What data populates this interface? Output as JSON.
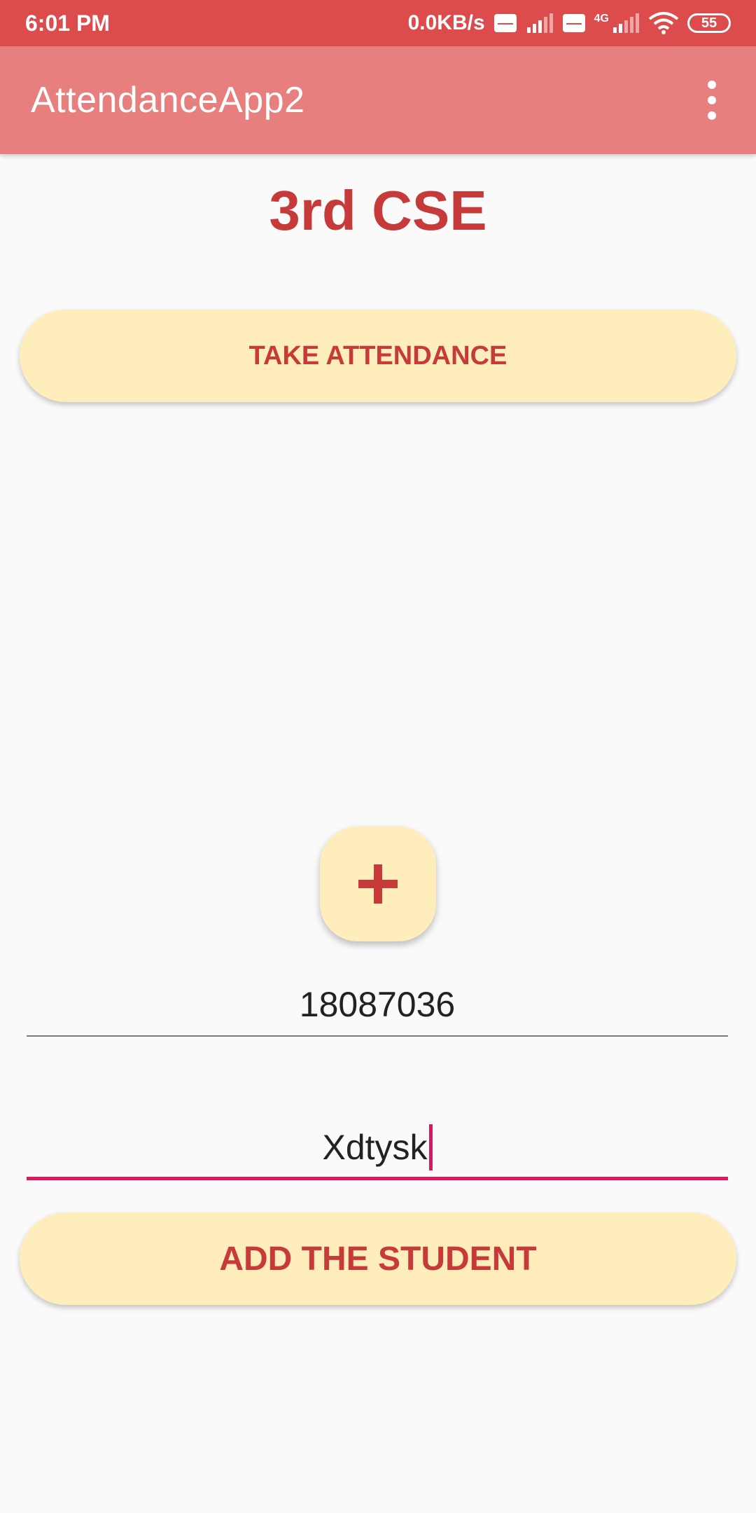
{
  "status_bar": {
    "time": "6:01 PM",
    "network_speed": "0.0KB/s",
    "volte1_icon": "volte-icon",
    "signal1_icon": "signal-icon",
    "volte2_icon": "volte-icon",
    "network_type": "4G",
    "signal2_icon": "signal-icon",
    "wifi_icon": "wifi-icon",
    "battery_level": "55"
  },
  "app_bar": {
    "title": "AttendanceApp2",
    "menu_icon": "more-vert-icon"
  },
  "main": {
    "class_title": "3rd CSE",
    "take_attendance_label": "TAKE ATTENDANCE",
    "fab_icon": "plus-icon",
    "roll_input_value": "18087036",
    "name_input_value": "Xdtysk",
    "add_student_label": "ADD THE STUDENT"
  },
  "colors": {
    "status_bar": "#DC4C4C",
    "app_bar": "#E77F7F",
    "accent_text": "#C73A3A",
    "button_background": "#FFEDBC",
    "focus_underline": "#D81B60"
  }
}
